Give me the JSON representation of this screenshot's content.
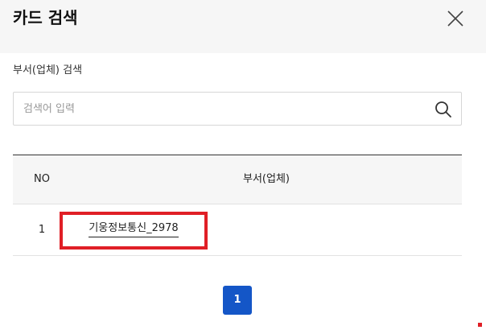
{
  "header": {
    "title": "카드 검색",
    "close_icon": "close-icon"
  },
  "search": {
    "label": "부서(업체) 검색",
    "placeholder": "검색어 입력",
    "value": "",
    "icon": "search-icon"
  },
  "table": {
    "columns": [
      "NO",
      "부서(업체)"
    ],
    "rows": [
      {
        "no": "1",
        "dept": "기웅정보통신_2978",
        "highlighted": true
      }
    ]
  },
  "pagination": {
    "pages": [
      "1"
    ],
    "current": "1"
  },
  "colors": {
    "header_bg": "#f6f6f6",
    "accent": "#1456c7",
    "highlight": "#e01f26"
  }
}
